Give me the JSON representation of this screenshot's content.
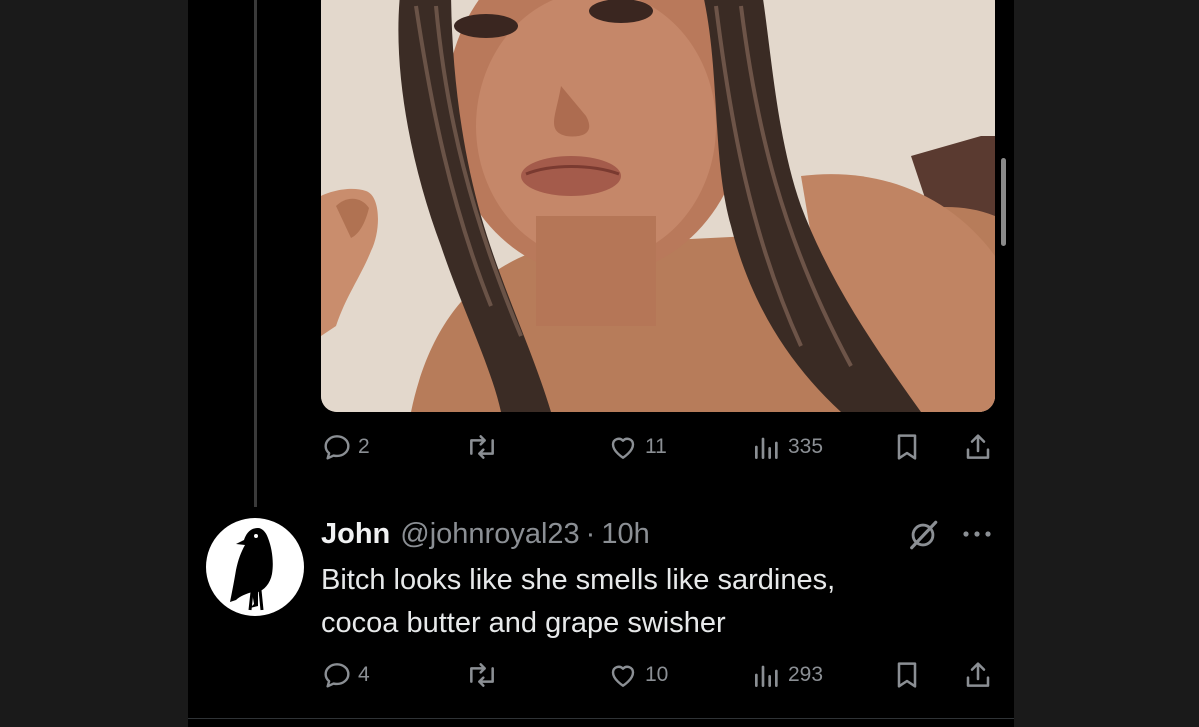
{
  "tweet": {
    "media_alt": "",
    "actions": {
      "replies": "2",
      "reposts": "",
      "likes": "11",
      "views": "335"
    }
  },
  "reply": {
    "name": "John",
    "handle": "@johnroyal23",
    "separator": "·",
    "time": "10h",
    "text_line1": "Bitch looks like she smells like sardines,",
    "text_line2": "cocoa butter and grape swisher",
    "actions": {
      "replies": "4",
      "reposts": "",
      "likes": "10",
      "views": "293"
    }
  },
  "icons": {
    "reply": "reply-icon",
    "repost": "repost-icon",
    "like": "heart-icon",
    "views": "views-icon",
    "bookmark": "bookmark-icon",
    "share": "share-icon",
    "grok": "grok-icon",
    "more": "more-icon",
    "avatar": "crow-silhouette"
  },
  "colors": {
    "background": "#000000",
    "gutter": "#1a1a1a",
    "text": "#e7e9ea",
    "muted": "#8b8f94"
  }
}
